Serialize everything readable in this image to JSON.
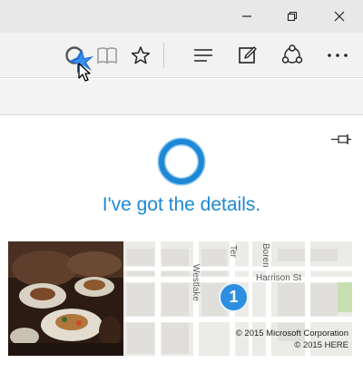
{
  "window_controls": {
    "minimize_icon": "minimize-icon",
    "restore_icon": "restore-icon",
    "close_icon": "close-icon"
  },
  "toolbar": {
    "icons": [
      "cortana-search-icon",
      "reading-view-icon",
      "favorites-star-icon",
      "hub-icon",
      "web-note-icon",
      "share-icon",
      "more-icon"
    ]
  },
  "cortana_panel": {
    "message": "I've got the details.",
    "accent_color": "#1e88d6"
  },
  "map": {
    "streets": {
      "westlake": "Westlake",
      "terry": "Ter",
      "boren": "Boren",
      "harrison": "Harrison St"
    },
    "marker_label": "1",
    "copyright_line1": "© 2015 Microsoft Corporation",
    "copyright_line2": "© 2015 HERE"
  }
}
